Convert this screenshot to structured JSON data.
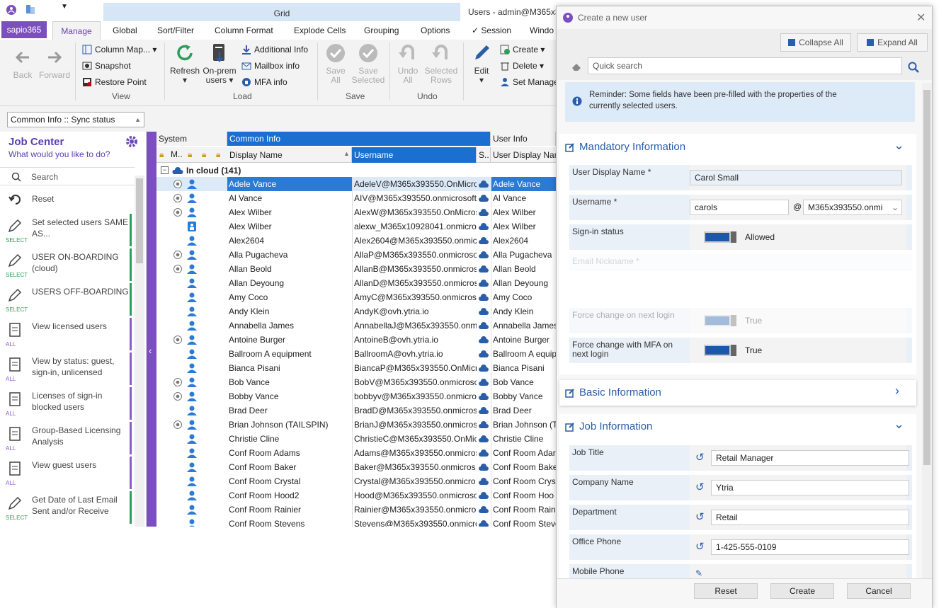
{
  "window": {
    "title": "Users - admin@M365x3",
    "grid_tab": "Grid"
  },
  "ribbon_tabs": [
    "sapio365",
    "Manage",
    "Global",
    "Sort/Filter",
    "Column Format",
    "Explode Cells",
    "Grouping",
    "Options",
    "✓ Session",
    "Windo"
  ],
  "ribbon": {
    "back": "Back",
    "forward": "Forward",
    "column_map": "Column Map...",
    "snapshot": "Snapshot",
    "restore_point": "Restore Point",
    "group_view": "View",
    "refresh": "Refresh",
    "onprem": "On-prem users",
    "additional_info": "Additional Info",
    "mailbox_info": "Mailbox info",
    "mfa_info": "MFA info",
    "group_load": "Load",
    "save_all": "Save All",
    "save_selected": "Save Selected",
    "group_save": "Save",
    "undo_all": "Undo All",
    "selected_rows": "Selected Rows",
    "group_undo": "Undo",
    "edit": "Edit",
    "create": "Create",
    "delete": "Delete",
    "set_manager": "Set Manage"
  },
  "filter_box": "Common Info :: Sync status",
  "job_center": {
    "title": "Job Center",
    "subtitle": "What would you like to do?",
    "search": "Search",
    "reset": "Reset",
    "items": [
      {
        "label": "Set selected users SAME AS...",
        "tag": "SELECT"
      },
      {
        "label": "USER ON-BOARDING (cloud)",
        "tag": "SELECT"
      },
      {
        "label": "USERS OFF-BOARDING",
        "tag": "SELECT"
      },
      {
        "label": "View licensed users",
        "tag": "ALL"
      },
      {
        "label": "View by status: guest, sign-in, unlicensed",
        "tag": "ALL"
      },
      {
        "label": "Licenses of sign-in blocked users",
        "tag": "ALL"
      },
      {
        "label": "Group-Based Licensing Analysis",
        "tag": "ALL"
      },
      {
        "label": "View guest users",
        "tag": "ALL"
      },
      {
        "label": "Get Date of Last Email Sent and/or Receive",
        "tag": "SELECT"
      }
    ]
  },
  "grid": {
    "group_headers": {
      "system": "System",
      "common": "Common Info",
      "user": "User Info"
    },
    "col_headers": {
      "m": "M..",
      "display": "Display Name",
      "username": "Username",
      "s": "S..",
      "user_display": "User Display Nam"
    },
    "group_row": "In cloud (141)",
    "rows": [
      {
        "d": "Adele Vance",
        "u": "AdeleV@M365x393550.OnMicros",
        "n": "Adele Vance"
      },
      {
        "d": "Al Vance",
        "u": "AIV@M365x393550.onmicrosoft.",
        "n": "Al Vance"
      },
      {
        "d": "Alex Wilber",
        "u": "AlexW@M365x393550.OnMicros",
        "n": "Alex Wilber"
      },
      {
        "d": "Alex Wilber",
        "u": "alexw_M365x10928041.onmicros",
        "n": "Alex Wilber"
      },
      {
        "d": "Alex2604",
        "u": "Alex2604@M365x393550.onmicr",
        "n": "Alex2604"
      },
      {
        "d": "Alla Pugacheva",
        "u": "AllaP@M365x393550.onmicrosol",
        "n": "Alla Pugacheva"
      },
      {
        "d": "Allan Beold",
        "u": "AllanB@M365x393550.onmicros",
        "n": "Allan Beold"
      },
      {
        "d": "Allan Deyoung",
        "u": "AllanD@M365x393550.onmicros",
        "n": "Allan Deyoung"
      },
      {
        "d": "Amy Coco",
        "u": "AmyC@M365x393550.onmicros",
        "n": "Amy Coco"
      },
      {
        "d": "Andy Klein",
        "u": "AndyK@ovh.ytria.io",
        "n": "Andy Klein"
      },
      {
        "d": "Annabella James",
        "u": "AnnabellaJ@M365x393550.onmi",
        "n": "Annabella James"
      },
      {
        "d": "Antoine Burger",
        "u": "AntoineB@ovh.ytria.io",
        "n": "Antoine Burger"
      },
      {
        "d": "Ballroom A equipment",
        "u": "BallroomA@ovh.ytria.io",
        "n": "Ballroom A equip"
      },
      {
        "d": "Bianca Pisani",
        "u": "BiancaP@M365x393550.OnMicr",
        "n": "Bianca Pisani"
      },
      {
        "d": "Bob Vance",
        "u": "BobV@M365x393550.onmicroso",
        "n": "Bob Vance"
      },
      {
        "d": "Bobby Vance",
        "u": "bobbyv@M365x393550.onmicro",
        "n": "Bobby Vance"
      },
      {
        "d": "Brad Deer",
        "u": "BradD@M365x393550.onmicros",
        "n": "Brad Deer"
      },
      {
        "d": "Brian Johnson (TAILSPIN)",
        "u": "BrianJ@M365x393550.onmicros",
        "n": "Brian Johnson (T"
      },
      {
        "d": "Christie Cline",
        "u": "ChristieC@M365x393550.OnMic",
        "n": "Christie Cline"
      },
      {
        "d": "Conf Room Adams",
        "u": "Adams@M365x393550.onmicros",
        "n": "Conf Room Adar"
      },
      {
        "d": "Conf Room Baker",
        "u": "Baker@M365x393550.onmicros",
        "n": "Conf Room Bake"
      },
      {
        "d": "Conf Room Crystal",
        "u": "Crystal@M365x393550.onmicro",
        "n": "Conf Room Cryst"
      },
      {
        "d": "Conf Room Hood2",
        "u": "Hood@M365x393550.onmicroso",
        "n": "Conf Room Hoo"
      },
      {
        "d": "Conf Room Rainier",
        "u": "Rainier@M365x393550.onmicro",
        "n": "Conf Room Raini"
      },
      {
        "d": "Conf Room Stevens",
        "u": "Stevens@M365x393550.onmicro",
        "n": "Conf Room Steve"
      }
    ]
  },
  "dialog": {
    "title": "Create a new user",
    "collapse_all": "Collapse All",
    "expand_all": "Expand All",
    "quick_search": "Quick search",
    "reminder": "Reminder: Some fields have been pre-filled with the properties of the currently selected users.",
    "mandatory": {
      "title": "Mandatory Information",
      "user_display_label": "User Display Name *",
      "user_display_value": "Carol Small",
      "username_label": "Username *",
      "username_value": "carols",
      "at": "@",
      "domain_value": "M365x393550.onmi",
      "signin_label": "Sign-in status",
      "signin_value": "Allowed",
      "email_nick_label": "Email Nickname *",
      "force_change_label": "Force change on next login",
      "force_change_value": "True",
      "force_mfa_label": "Force change with MFA on next login",
      "force_mfa_value": "True"
    },
    "basic": {
      "title": "Basic Information"
    },
    "job": {
      "title": "Job Information",
      "job_title_label": "Job Title",
      "job_title_value": "Retail Manager",
      "company_label": "Company Name",
      "company_value": "Ytria",
      "department_label": "Department",
      "department_value": "Retail",
      "office_phone_label": "Office Phone",
      "office_phone_value": "1-425-555-0109",
      "mobile_label": "Mobile Phone"
    },
    "reset": "Reset",
    "create": "Create",
    "cancel": "Cancel"
  }
}
